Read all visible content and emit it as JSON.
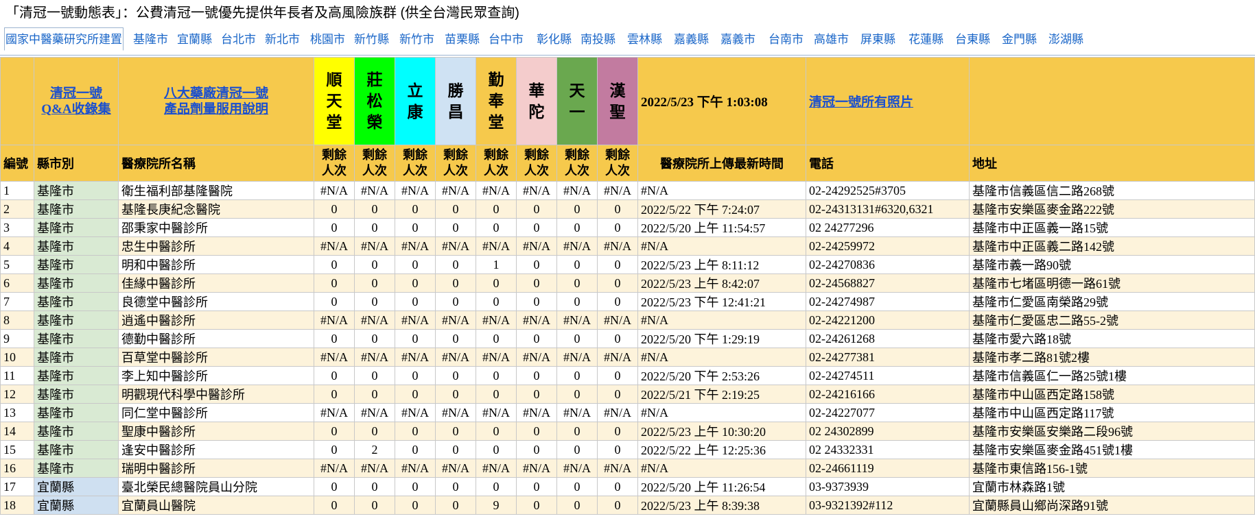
{
  "title": "「清冠一號動態表」：公費清冠一號優先提供年長者及高風險族群 (供全台灣民眾查詢)",
  "tabs": [
    "國家中醫藥研究所建置",
    "基隆市",
    "宜蘭縣",
    "台北市",
    "新北市",
    "桃園市",
    "新竹縣",
    "新竹市",
    "苗栗縣",
    "台中市",
    "彰化縣",
    "南投縣",
    "雲林縣",
    "嘉義縣",
    "嘉義市",
    "台南市",
    "高雄市",
    "屏東縣",
    "花蓮縣",
    "台東縣",
    "金門縣",
    "澎湖縣"
  ],
  "header": {
    "qa_link": "清冠一號\nQ&A收錄集",
    "explain_link": "八大藥廠清冠一號\n產品劑量服用說明",
    "brands": [
      {
        "name": "順天堂",
        "color": "#ffff00"
      },
      {
        "name": "莊松榮",
        "color": "#00ff00"
      },
      {
        "name": "立康",
        "color": "#00ffff"
      },
      {
        "name": "勝昌",
        "color": "#cfe2f3"
      },
      {
        "name": "勤奉堂",
        "color": "#f6c94c"
      },
      {
        "name": "華陀",
        "color": "#f4cccc"
      },
      {
        "name": "天一",
        "color": "#6aa84f"
      },
      {
        "name": "漢聖",
        "color": "#c27ba0"
      }
    ],
    "timestamp": "2022/5/23 下午 1:03:08",
    "photos_link": "清冠一號所有照片"
  },
  "columns": {
    "no": "編號",
    "city": "縣市別",
    "name": "醫療院所名稱",
    "remaining": "剩餘\n人次",
    "updated": "醫療院所上傳最新時間",
    "phone": "電話",
    "address": "地址"
  },
  "rows": [
    {
      "no": "1",
      "city": "基隆市",
      "name": "衛生福利部基隆醫院",
      "v": [
        "#N/A",
        "#N/A",
        "#N/A",
        "#N/A",
        "#N/A",
        "#N/A",
        "#N/A",
        "#N/A"
      ],
      "time": "#N/A",
      "phone": "02-24292525#3705",
      "addr": "基隆市信義區信二路268號"
    },
    {
      "no": "2",
      "city": "基隆市",
      "name": "基隆長庚紀念醫院",
      "v": [
        "0",
        "0",
        "0",
        "0",
        "0",
        "0",
        "0",
        "0"
      ],
      "time": "2022/5/22 下午 7:24:07",
      "phone": "02-24313131#6320,6321",
      "addr": "基隆市安樂區麥金路222號"
    },
    {
      "no": "3",
      "city": "基隆市",
      "name": "邵秉家中醫診所",
      "v": [
        "0",
        "0",
        "0",
        "0",
        "0",
        "0",
        "0",
        "0"
      ],
      "time": "2022/5/20 上午 11:54:57",
      "phone": "02 24277296",
      "addr": "基隆市中正區義一路15號"
    },
    {
      "no": "4",
      "city": "基隆市",
      "name": "忠生中醫診所",
      "v": [
        "#N/A",
        "#N/A",
        "#N/A",
        "#N/A",
        "#N/A",
        "#N/A",
        "#N/A",
        "#N/A"
      ],
      "time": "#N/A",
      "phone": "02-24259972",
      "addr": "基隆市中正區義二路142號"
    },
    {
      "no": "5",
      "city": "基隆市",
      "name": "明和中醫診所",
      "v": [
        "0",
        "0",
        "0",
        "0",
        "1",
        "0",
        "0",
        "0"
      ],
      "time": "2022/5/23 上午 8:11:12",
      "phone": "02-24270836",
      "addr": "基隆市義一路90號"
    },
    {
      "no": "6",
      "city": "基隆市",
      "name": "佳緣中醫診所",
      "v": [
        "0",
        "0",
        "0",
        "0",
        "0",
        "0",
        "0",
        "0"
      ],
      "time": "2022/5/23 上午 8:42:07",
      "phone": "02-24568827",
      "addr": "基隆市七堵區明德一路61號"
    },
    {
      "no": "7",
      "city": "基隆市",
      "name": "良德堂中醫診所",
      "v": [
        "0",
        "0",
        "0",
        "0",
        "0",
        "0",
        "0",
        "0"
      ],
      "time": "2022/5/23 下午 12:41:21",
      "phone": "02-24274987",
      "addr": "基隆市仁愛區南榮路29號"
    },
    {
      "no": "8",
      "city": "基隆市",
      "name": "逍遙中醫診所",
      "v": [
        "#N/A",
        "#N/A",
        "#N/A",
        "#N/A",
        "#N/A",
        "#N/A",
        "#N/A",
        "#N/A"
      ],
      "time": "#N/A",
      "phone": "02-24221200",
      "addr": "基隆市仁愛區忠二路55-2號"
    },
    {
      "no": "9",
      "city": "基隆市",
      "name": "德勤中醫診所",
      "v": [
        "0",
        "0",
        "0",
        "0",
        "0",
        "0",
        "0",
        "0"
      ],
      "time": "2022/5/20 下午 1:29:19",
      "phone": "02-24261268",
      "addr": "基隆市愛六路18號"
    },
    {
      "no": "10",
      "city": "基隆市",
      "name": "百草堂中醫診所",
      "v": [
        "#N/A",
        "#N/A",
        "#N/A",
        "#N/A",
        "#N/A",
        "#N/A",
        "#N/A",
        "#N/A"
      ],
      "time": "#N/A",
      "phone": "02-24277381",
      "addr": "基隆市孝二路81號2樓"
    },
    {
      "no": "11",
      "city": "基隆市",
      "name": "李上知中醫診所",
      "v": [
        "0",
        "0",
        "0",
        "0",
        "0",
        "0",
        "0",
        "0"
      ],
      "time": "2022/5/20 下午 2:53:26",
      "phone": "02-24274511",
      "addr": "基隆市信義區仁一路25號1樓"
    },
    {
      "no": "12",
      "city": "基隆市",
      "name": "明觀現代科學中醫診所",
      "v": [
        "0",
        "0",
        "0",
        "0",
        "0",
        "0",
        "0",
        "0"
      ],
      "time": "2022/5/21 下午 2:19:25",
      "phone": "02-24216166",
      "addr": "基隆市中山區西定路158號"
    },
    {
      "no": "13",
      "city": "基隆市",
      "name": "同仁堂中醫診所",
      "v": [
        "#N/A",
        "#N/A",
        "#N/A",
        "#N/A",
        "#N/A",
        "#N/A",
        "#N/A",
        "#N/A"
      ],
      "time": "#N/A",
      "phone": "02-24227077",
      "addr": "基隆市中山區西定路117號"
    },
    {
      "no": "14",
      "city": "基隆市",
      "name": "聖康中醫診所",
      "v": [
        "0",
        "0",
        "0",
        "0",
        "0",
        "0",
        "0",
        "0"
      ],
      "time": "2022/5/23 上午 10:30:20",
      "phone": "02 24302899",
      "addr": "基隆市安樂區安樂路二段96號"
    },
    {
      "no": "15",
      "city": "基隆市",
      "name": "逢安中醫診所",
      "v": [
        "0",
        "2",
        "0",
        "0",
        "0",
        "0",
        "0",
        "0"
      ],
      "time": "2022/5/22 上午 12:25:36",
      "phone": "02 24332331",
      "addr": "基隆市安樂區麥金路451號1樓"
    },
    {
      "no": "16",
      "city": "基隆市",
      "name": "瑞明中醫診所",
      "v": [
        "#N/A",
        "#N/A",
        "#N/A",
        "#N/A",
        "#N/A",
        "#N/A",
        "#N/A",
        "#N/A"
      ],
      "time": "#N/A",
      "phone": "02-24661119",
      "addr": "基隆市東信路156-1號"
    },
    {
      "no": "17",
      "city": "宜蘭縣",
      "name": "臺北榮民總醫院員山分院",
      "v": [
        "0",
        "0",
        "0",
        "0",
        "0",
        "0",
        "0",
        "0"
      ],
      "time": "2022/5/20 上午 11:26:54",
      "phone": "03-9373939",
      "addr": "宜蘭市林森路1號"
    },
    {
      "no": "18",
      "city": "宜蘭縣",
      "name": "宜蘭員山醫院",
      "v": [
        "0",
        "0",
        "0",
        "0",
        "9",
        "0",
        "0",
        "0"
      ],
      "time": "2022/5/23 上午 8:39:38",
      "phone": "03-9321392#112",
      "addr": "宜蘭縣員山鄉尚深路91號"
    }
  ]
}
